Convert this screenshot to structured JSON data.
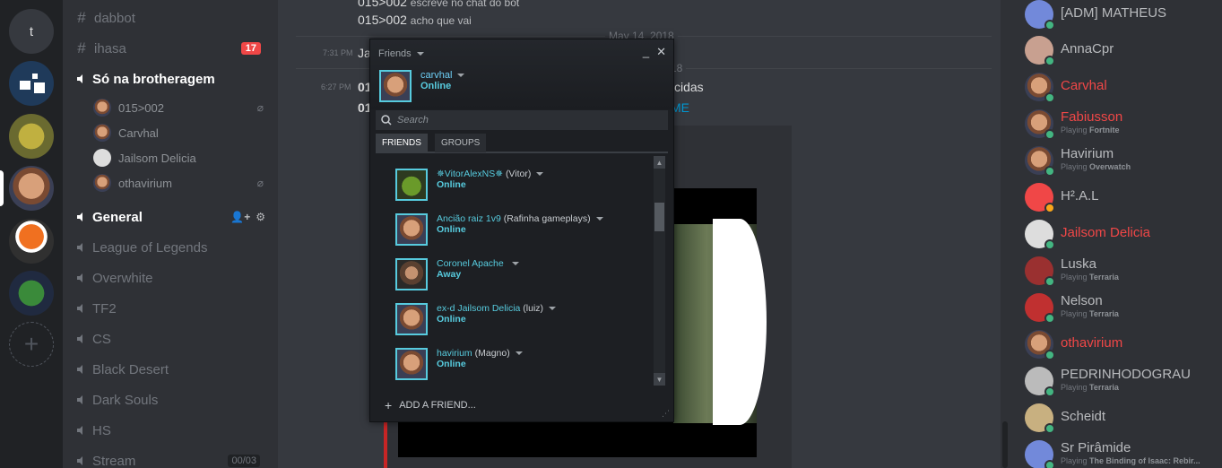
{
  "guilds": {
    "letter": "t"
  },
  "channels": {
    "text": [
      {
        "name": "dabbot"
      },
      {
        "name": "ihasa",
        "badge": "17"
      }
    ],
    "voice_active": {
      "name": "Só na brotheragem",
      "users": [
        "015>002",
        "Carvhal",
        "Jailsom Delicia",
        "othavirium"
      ]
    },
    "voice_general": {
      "name": "General"
    },
    "voice": [
      "League of Legends",
      "Overwhite",
      "TF2",
      "CS",
      "Black Desert",
      "Dark Souls",
      "HS",
      "Stream"
    ],
    "stream_count": "00/03"
  },
  "chat": {
    "line1_user": "015>002",
    "line1_text": "escreve no chat do bot",
    "line2_user": "015>002",
    "line2_text": "acho que vai",
    "date1": "May 14, 2018",
    "ts1": "7:31 PM",
    "ja_text": "Ja",
    "ts2": "6:27 PM",
    "l3_prefix": "01",
    "l3_suffix": "cidas",
    "l4_prefix": "01",
    "l4_link": "ME",
    "date2_partial": "18"
  },
  "steam": {
    "title": "Friends",
    "me_name": "carvhal",
    "me_status": "Online",
    "search_placeholder": "Search",
    "tab_friends": "FRIENDS",
    "tab_groups": "GROUPS",
    "friends": [
      {
        "name": "✵VitorAlexNS✵",
        "nick": "(Vitor)",
        "status": "Online"
      },
      {
        "name": "Ancião raiz 1v9",
        "nick": "(Rafinha gameplays)",
        "status": "Online"
      },
      {
        "name": "Coronel Apache",
        "nick": "",
        "status": "Away"
      },
      {
        "name": "ex-d Jailsom Delicia",
        "nick": "(luiz)",
        "status": "Online"
      },
      {
        "name": "havirium",
        "nick": "(Magno)",
        "status": "Online"
      }
    ],
    "add_friend": "ADD A FRIEND..."
  },
  "members": [
    {
      "name": "[ADM] MATHEUS",
      "color": "#b9bbbe"
    },
    {
      "name": "AnnaCpr",
      "color": "#b9bbbe"
    },
    {
      "name": "Carvhal",
      "color": "#f04747"
    },
    {
      "name": "Fabiusson",
      "color": "#f04747",
      "playing": "Fortnite"
    },
    {
      "name": "Havirium",
      "color": "#b9bbbe",
      "playing": "Overwatch"
    },
    {
      "name": "H².A.L",
      "color": "#b9bbbe"
    },
    {
      "name": "Jailsom Delicia",
      "color": "#f04747"
    },
    {
      "name": "Luska",
      "color": "#b9bbbe",
      "playing": "Terraria"
    },
    {
      "name": "Nelson",
      "color": "#b9bbbe",
      "playing": "Terraria"
    },
    {
      "name": "othavirium",
      "color": "#f04747"
    },
    {
      "name": "PEDRINHODOGRAU",
      "color": "#b9bbbe",
      "playing": "Terraria"
    },
    {
      "name": "Scheidt",
      "color": "#b9bbbe"
    },
    {
      "name": "Sr Pirâmide",
      "color": "#b9bbbe",
      "playing": "The Binding of Isaac: Rebir..."
    }
  ],
  "playing_label": "Playing"
}
